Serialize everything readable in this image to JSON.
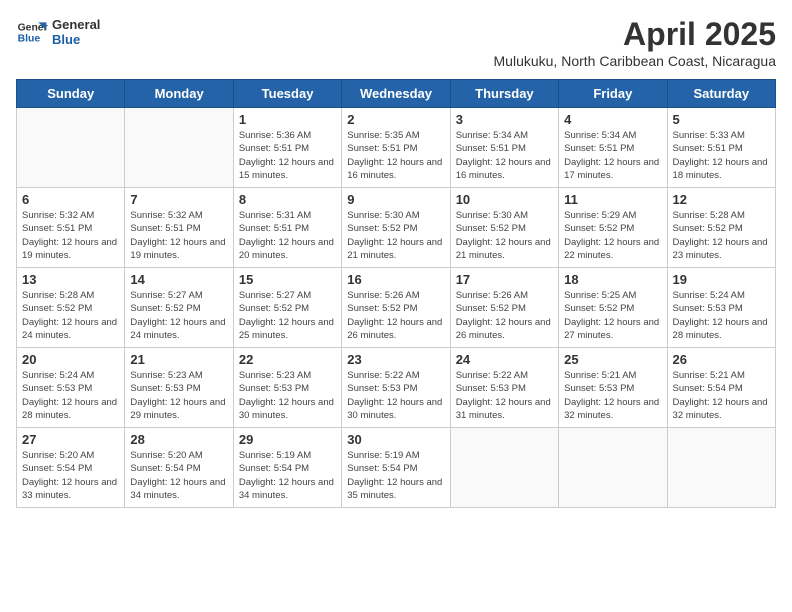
{
  "logo": {
    "line1": "General",
    "line2": "Blue"
  },
  "calendar": {
    "title": "April 2025",
    "subtitle": "Mulukuku, North Caribbean Coast, Nicaragua",
    "days_of_week": [
      "Sunday",
      "Monday",
      "Tuesday",
      "Wednesday",
      "Thursday",
      "Friday",
      "Saturday"
    ],
    "weeks": [
      [
        {
          "num": "",
          "sunrise": "",
          "sunset": "",
          "daylight": "",
          "empty": true
        },
        {
          "num": "",
          "sunrise": "",
          "sunset": "",
          "daylight": "",
          "empty": true
        },
        {
          "num": "1",
          "sunrise": "Sunrise: 5:36 AM",
          "sunset": "Sunset: 5:51 PM",
          "daylight": "Daylight: 12 hours and 15 minutes."
        },
        {
          "num": "2",
          "sunrise": "Sunrise: 5:35 AM",
          "sunset": "Sunset: 5:51 PM",
          "daylight": "Daylight: 12 hours and 16 minutes."
        },
        {
          "num": "3",
          "sunrise": "Sunrise: 5:34 AM",
          "sunset": "Sunset: 5:51 PM",
          "daylight": "Daylight: 12 hours and 16 minutes."
        },
        {
          "num": "4",
          "sunrise": "Sunrise: 5:34 AM",
          "sunset": "Sunset: 5:51 PM",
          "daylight": "Daylight: 12 hours and 17 minutes."
        },
        {
          "num": "5",
          "sunrise": "Sunrise: 5:33 AM",
          "sunset": "Sunset: 5:51 PM",
          "daylight": "Daylight: 12 hours and 18 minutes."
        }
      ],
      [
        {
          "num": "6",
          "sunrise": "Sunrise: 5:32 AM",
          "sunset": "Sunset: 5:51 PM",
          "daylight": "Daylight: 12 hours and 19 minutes."
        },
        {
          "num": "7",
          "sunrise": "Sunrise: 5:32 AM",
          "sunset": "Sunset: 5:51 PM",
          "daylight": "Daylight: 12 hours and 19 minutes."
        },
        {
          "num": "8",
          "sunrise": "Sunrise: 5:31 AM",
          "sunset": "Sunset: 5:51 PM",
          "daylight": "Daylight: 12 hours and 20 minutes."
        },
        {
          "num": "9",
          "sunrise": "Sunrise: 5:30 AM",
          "sunset": "Sunset: 5:52 PM",
          "daylight": "Daylight: 12 hours and 21 minutes."
        },
        {
          "num": "10",
          "sunrise": "Sunrise: 5:30 AM",
          "sunset": "Sunset: 5:52 PM",
          "daylight": "Daylight: 12 hours and 21 minutes."
        },
        {
          "num": "11",
          "sunrise": "Sunrise: 5:29 AM",
          "sunset": "Sunset: 5:52 PM",
          "daylight": "Daylight: 12 hours and 22 minutes."
        },
        {
          "num": "12",
          "sunrise": "Sunrise: 5:28 AM",
          "sunset": "Sunset: 5:52 PM",
          "daylight": "Daylight: 12 hours and 23 minutes."
        }
      ],
      [
        {
          "num": "13",
          "sunrise": "Sunrise: 5:28 AM",
          "sunset": "Sunset: 5:52 PM",
          "daylight": "Daylight: 12 hours and 24 minutes."
        },
        {
          "num": "14",
          "sunrise": "Sunrise: 5:27 AM",
          "sunset": "Sunset: 5:52 PM",
          "daylight": "Daylight: 12 hours and 24 minutes."
        },
        {
          "num": "15",
          "sunrise": "Sunrise: 5:27 AM",
          "sunset": "Sunset: 5:52 PM",
          "daylight": "Daylight: 12 hours and 25 minutes."
        },
        {
          "num": "16",
          "sunrise": "Sunrise: 5:26 AM",
          "sunset": "Sunset: 5:52 PM",
          "daylight": "Daylight: 12 hours and 26 minutes."
        },
        {
          "num": "17",
          "sunrise": "Sunrise: 5:26 AM",
          "sunset": "Sunset: 5:52 PM",
          "daylight": "Daylight: 12 hours and 26 minutes."
        },
        {
          "num": "18",
          "sunrise": "Sunrise: 5:25 AM",
          "sunset": "Sunset: 5:52 PM",
          "daylight": "Daylight: 12 hours and 27 minutes."
        },
        {
          "num": "19",
          "sunrise": "Sunrise: 5:24 AM",
          "sunset": "Sunset: 5:53 PM",
          "daylight": "Daylight: 12 hours and 28 minutes."
        }
      ],
      [
        {
          "num": "20",
          "sunrise": "Sunrise: 5:24 AM",
          "sunset": "Sunset: 5:53 PM",
          "daylight": "Daylight: 12 hours and 28 minutes."
        },
        {
          "num": "21",
          "sunrise": "Sunrise: 5:23 AM",
          "sunset": "Sunset: 5:53 PM",
          "daylight": "Daylight: 12 hours and 29 minutes."
        },
        {
          "num": "22",
          "sunrise": "Sunrise: 5:23 AM",
          "sunset": "Sunset: 5:53 PM",
          "daylight": "Daylight: 12 hours and 30 minutes."
        },
        {
          "num": "23",
          "sunrise": "Sunrise: 5:22 AM",
          "sunset": "Sunset: 5:53 PM",
          "daylight": "Daylight: 12 hours and 30 minutes."
        },
        {
          "num": "24",
          "sunrise": "Sunrise: 5:22 AM",
          "sunset": "Sunset: 5:53 PM",
          "daylight": "Daylight: 12 hours and 31 minutes."
        },
        {
          "num": "25",
          "sunrise": "Sunrise: 5:21 AM",
          "sunset": "Sunset: 5:53 PM",
          "daylight": "Daylight: 12 hours and 32 minutes."
        },
        {
          "num": "26",
          "sunrise": "Sunrise: 5:21 AM",
          "sunset": "Sunset: 5:54 PM",
          "daylight": "Daylight: 12 hours and 32 minutes."
        }
      ],
      [
        {
          "num": "27",
          "sunrise": "Sunrise: 5:20 AM",
          "sunset": "Sunset: 5:54 PM",
          "daylight": "Daylight: 12 hours and 33 minutes."
        },
        {
          "num": "28",
          "sunrise": "Sunrise: 5:20 AM",
          "sunset": "Sunset: 5:54 PM",
          "daylight": "Daylight: 12 hours and 34 minutes."
        },
        {
          "num": "29",
          "sunrise": "Sunrise: 5:19 AM",
          "sunset": "Sunset: 5:54 PM",
          "daylight": "Daylight: 12 hours and 34 minutes."
        },
        {
          "num": "30",
          "sunrise": "Sunrise: 5:19 AM",
          "sunset": "Sunset: 5:54 PM",
          "daylight": "Daylight: 12 hours and 35 minutes."
        },
        {
          "num": "",
          "sunrise": "",
          "sunset": "",
          "daylight": "",
          "empty": true
        },
        {
          "num": "",
          "sunrise": "",
          "sunset": "",
          "daylight": "",
          "empty": true
        },
        {
          "num": "",
          "sunrise": "",
          "sunset": "",
          "daylight": "",
          "empty": true
        }
      ]
    ]
  }
}
